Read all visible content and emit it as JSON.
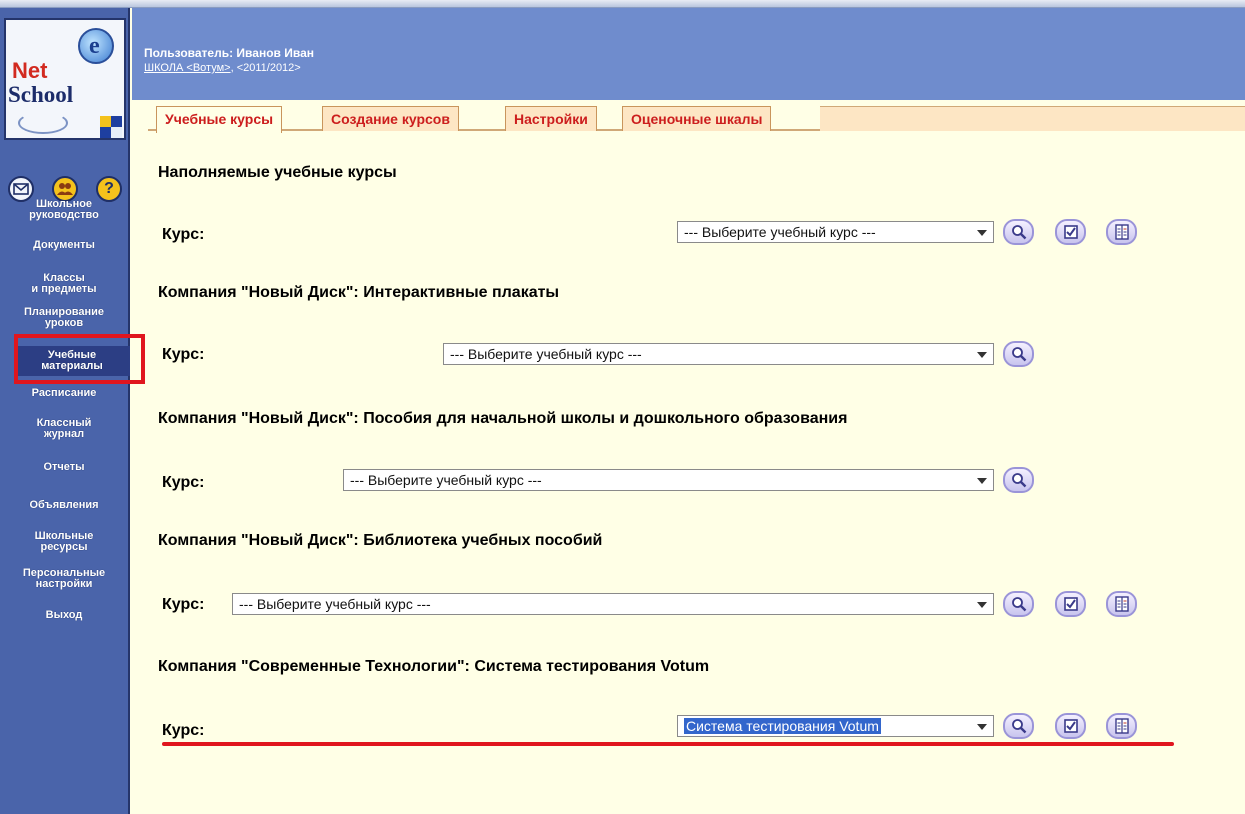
{
  "logo": {
    "net": "Net",
    "school": "School"
  },
  "sidebar": {
    "items": [
      {
        "label": "Школьное\nруководство"
      },
      {
        "label": "Документы"
      },
      {
        "label": "Классы\nи предметы"
      },
      {
        "label": "Планирование\nуроков"
      },
      {
        "label": "Учебные\nматериалы"
      },
      {
        "label": "Расписание"
      },
      {
        "label": "Классный\nжурнал"
      },
      {
        "label": "Отчеты"
      },
      {
        "label": "Объявления"
      },
      {
        "label": "Школьные\nресурсы"
      },
      {
        "label": "Персональные\nнастройки"
      },
      {
        "label": "Выход"
      }
    ],
    "help_glyph": "?"
  },
  "header": {
    "user": "Пользователь: Иванов Иван",
    "school_link": "ШКОЛА <Вотум>",
    "school_year": ", <2011/2012>"
  },
  "tabs": [
    {
      "label": "Учебные курсы"
    },
    {
      "label": "Создание курсов"
    },
    {
      "label": "Настройки"
    },
    {
      "label": "Оценочные шкалы"
    }
  ],
  "sections": [
    {
      "heading": "Наполняемые учебные курсы",
      "label": "Курс:",
      "select_value": "--- Выберите учебный курс ---"
    },
    {
      "heading": "Компания \"Новый Диск\": Интерактивные плакаты",
      "label": "Курс:",
      "select_value": "--- Выберите учебный курс ---"
    },
    {
      "heading": "Компания \"Новый Диск\": Пособия для начальной школы и дошкольного образования",
      "label": "Курс:",
      "select_value": "--- Выберите учебный курс ---"
    },
    {
      "heading": "Компания \"Новый Диск\": Библиотека учебных пособий",
      "label": "Курс:",
      "select_value": "--- Выберите учебный курс ---"
    },
    {
      "heading": "Компания \"Современные Технологии\": Система тестирования Votum",
      "label": "Курс:",
      "select_value": "Система тестирования Votum"
    }
  ],
  "colors": {
    "accent_red": "#e0161e",
    "sidebar_blue": "#4a64aa",
    "header_blue": "#6f8ccd",
    "tab_text": "#cc1d1d",
    "content_bg": "#ffffe6"
  }
}
